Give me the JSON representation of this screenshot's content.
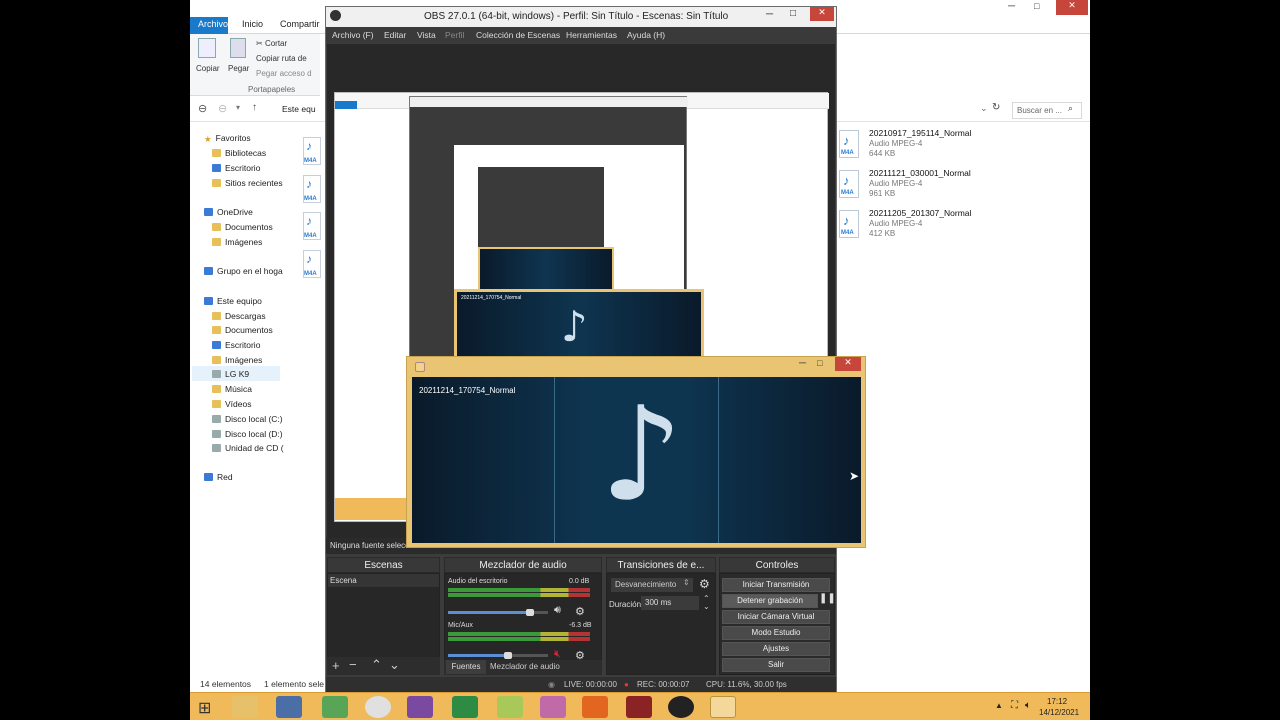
{
  "explorer": {
    "tabs": [
      "Archivo",
      "Inicio",
      "Compartir"
    ],
    "ribbon": {
      "copy": "Copiar",
      "paste": "Pegar",
      "cut": "Cortar",
      "copy_path": "Copiar ruta de",
      "paste_shortcut": "Pegar acceso d",
      "group": "Portapapeles"
    },
    "address": "Este equ",
    "search_placeholder": "Buscar en ...",
    "tree": [
      {
        "label": "Favoritos",
        "icon": "star-icon"
      },
      {
        "label": "Bibliotecas",
        "icon": "folder-icon"
      },
      {
        "label": "Escritorio",
        "icon": "desktop-icon"
      },
      {
        "label": "Sitios recientes",
        "icon": "folder-icon"
      },
      {
        "label": "OneDrive",
        "icon": "cloud-icon"
      },
      {
        "label": "Documentos",
        "icon": "folder-icon"
      },
      {
        "label": "Imágenes",
        "icon": "folder-icon"
      },
      {
        "label": "Grupo en el hoga",
        "icon": "homegroup-icon"
      },
      {
        "label": "Este equipo",
        "icon": "computer-icon"
      },
      {
        "label": "Descargas",
        "icon": "folder-icon"
      },
      {
        "label": "Documentos",
        "icon": "folder-icon"
      },
      {
        "label": "Escritorio",
        "icon": "desktop-icon"
      },
      {
        "label": "Imágenes",
        "icon": "folder-icon"
      },
      {
        "label": "LG K9",
        "icon": "phone-icon"
      },
      {
        "label": "Música",
        "icon": "music-folder-icon"
      },
      {
        "label": "Vídeos",
        "icon": "video-folder-icon"
      },
      {
        "label": "Disco local (C:)",
        "icon": "drive-icon"
      },
      {
        "label": "Disco local (D:)",
        "icon": "drive-icon"
      },
      {
        "label": "Unidad de CD (",
        "icon": "cd-drive-icon"
      },
      {
        "label": "Red",
        "icon": "network-icon"
      }
    ],
    "files": [
      {
        "name": "20210917_195114_Normal",
        "type": "Audio MPEG-4",
        "size": "644 KB",
        "ext": "M4A"
      },
      {
        "name": "20211121_030001_Normal",
        "type": "Audio MPEG-4",
        "size": "961 KB",
        "ext": "M4A"
      },
      {
        "name": "20211205_201307_Normal",
        "type": "Audio MPEG-4",
        "size": "412 KB",
        "ext": "M4A"
      }
    ],
    "status_count": "14 elementos",
    "status_selected": "1 elemento sele"
  },
  "obs": {
    "title": "OBS 27.0.1 (64-bit, windows) - Perfil: Sin Título - Escenas: Sin Título",
    "menu": [
      "Archivo (F)",
      "Editar",
      "Vista",
      "Perfil",
      "Colección de Escenas",
      "Herramientas",
      "Ayuda (H)"
    ],
    "source_bar": "Ninguna fuente selecc",
    "docks": {
      "scenes": "Escenas",
      "mixer": "Mezclador de audio",
      "transitions": "Transiciones de e...",
      "controls": "Controles"
    },
    "scene_item": "Escena",
    "mixer": {
      "desktop_label": "Audio del escritorio",
      "desktop_db": "0.0 dB",
      "mic_label": "Mic/Aux",
      "mic_db": "-6.3 dB",
      "desktop_volume": 0.82,
      "mic_volume": 0.6
    },
    "transition": {
      "selected": "Desvanecimiento",
      "duration_label": "Duración",
      "duration": "300 ms"
    },
    "controls": [
      "Iniciar Transmisión",
      "Detener grabación",
      "Iniciar Cámara Virtual",
      "Modo Estudio",
      "Ajustes",
      "Salir"
    ],
    "bottom_tabs": [
      "Fuentes",
      "Mezclador de audio"
    ],
    "status": {
      "live": "LIVE: 00:00:00",
      "rec": "REC: 00:00:07",
      "cpu": "CPU: 11.6%, 30.00 fps"
    }
  },
  "player": {
    "track": "20211214_170754_Normal",
    "nested_track": "20211214_170754_Normal"
  },
  "taskbar": {
    "time": "17:12",
    "date": "14/12/2021"
  }
}
